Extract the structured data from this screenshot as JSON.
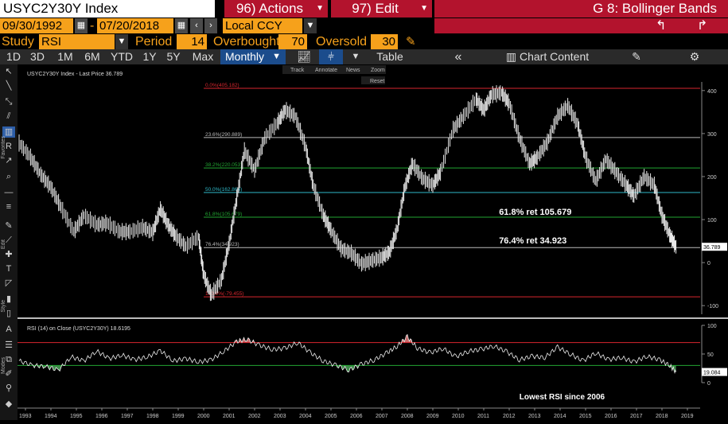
{
  "header": {
    "ticker": "USYC2Y30Y Index",
    "actions_label": "96) Actions",
    "edit_label": "97) Edit",
    "function_title": "G 8: Bollinger Bands"
  },
  "range": {
    "start_date": "09/30/1992",
    "end_date": "07/20/2018",
    "dash": "-",
    "currency": "Local CCY"
  },
  "study": {
    "study_label": "Study",
    "study_value": "RSI",
    "period_label": "Period",
    "period_value": "14",
    "overbought_label": "Overbought",
    "overbought_value": "70",
    "oversold_label": "Oversold",
    "oversold_value": "30"
  },
  "toolbar": {
    "periods": [
      "1D",
      "3D",
      "1M",
      "6M",
      "YTD",
      "1Y",
      "5Y",
      "Max"
    ],
    "frequency": "Monthly",
    "table_label": "Table",
    "chart_content_label": "Chart Content",
    "collapse_label": "«"
  },
  "chart_tools": {
    "track": "Track",
    "annotate": "Annotate",
    "news": "News",
    "zoom": "Zoom",
    "reset": "Reset"
  },
  "side_labels": {
    "favorites": "Favorites",
    "edit": "Edit",
    "style": "Style",
    "modes": "Modes"
  },
  "price_panel": {
    "legend": "USYC2Y30Y Index - Last Price 36.789",
    "last_price_tag": "36.789"
  },
  "rsi_panel": {
    "legend": "RSI (14) on Close (USYC2Y30Y) 18.6195",
    "last_tag": "19.084"
  },
  "chart_data": [
    {
      "type": "line",
      "title": "USYC2Y30Y Index - Last Price 36.789",
      "x_range": [
        1992.75,
        2019.5
      ],
      "ylim": [
        -120,
        420
      ],
      "y_ticks": [
        400,
        300,
        200,
        100,
        0,
        -100
      ],
      "x_ticks": [
        "1993",
        "1994",
        "1995",
        "1996",
        "1997",
        "1998",
        "1999",
        "2000",
        "2001",
        "2002",
        "2003",
        "2004",
        "2005",
        "2006",
        "2007",
        "2008",
        "2009",
        "2010",
        "2011",
        "2012",
        "2013",
        "2014",
        "2015",
        "2016",
        "2017",
        "2018",
        "2019"
      ],
      "grid": false,
      "fib_levels": [
        {
          "label": "0.0%(405.182)",
          "value": 405.182,
          "color": "#d9262e"
        },
        {
          "label": "23.6%(290.889)",
          "value": 290.889,
          "color": "#bbbbbb"
        },
        {
          "label": "38.2%(220.053)",
          "value": 220.053,
          "color": "#22a532"
        },
        {
          "label": "50.0%(162.864)",
          "value": 162.864,
          "color": "#2fb9c9"
        },
        {
          "label": "61.8%(105.679)",
          "value": 105.679,
          "color": "#22a532"
        },
        {
          "label": "76.4%(34.923)",
          "value": 34.923,
          "color": "#bbbbbb"
        },
        {
          "label": "100.0%(-79.455)",
          "value": -79.455,
          "color": "#d9262e"
        }
      ],
      "annotations": [
        "61.8% ret 105.679",
        "76.4% ret 34.923"
      ],
      "series": [
        {
          "x": [
            1992.75,
            1993.2,
            1993.6,
            1994.0,
            1994.4,
            1994.9,
            1995.3,
            1995.8,
            1996.2,
            1996.7,
            1997.1,
            1997.6,
            1998.0,
            1998.3,
            1998.6,
            1998.9,
            1999.3,
            1999.8,
            2000.0,
            2000.3,
            2000.7,
            2001.0,
            2001.3,
            2001.6,
            2002.0,
            2002.4,
            2002.9,
            2003.2,
            2003.6,
            2004.0,
            2004.3,
            2004.7,
            2005.0,
            2005.4,
            2005.8,
            2006.2,
            2006.6,
            2007.0,
            2007.3,
            2007.6,
            2007.9,
            2008.2,
            2008.6,
            2009.0,
            2009.3,
            2009.8,
            2010.2,
            2010.7,
            2011.0,
            2011.3,
            2011.7,
            2012.0,
            2012.4,
            2012.8,
            2013.1,
            2013.5,
            2013.9,
            2014.3,
            2014.7,
            2015.0,
            2015.4,
            2015.8,
            2016.2,
            2016.6,
            2016.9,
            2017.3,
            2017.7,
            2018.0,
            2018.3,
            2018.55
          ],
          "values": [
            278,
            245,
            205,
            175,
            128,
            72,
            110,
            88,
            92,
            72,
            72,
            82,
            70,
            125,
            88,
            62,
            38,
            60,
            -28,
            -75,
            -40,
            45,
            150,
            260,
            215,
            290,
            325,
            355,
            340,
            270,
            180,
            110,
            75,
            32,
            22,
            -3,
            5,
            12,
            25,
            78,
            175,
            230,
            195,
            180,
            210,
            310,
            340,
            380,
            355,
            390,
            395,
            370,
            290,
            230,
            245,
            280,
            340,
            365,
            320,
            245,
            190,
            240,
            210,
            180,
            155,
            200,
            180,
            110,
            65,
            36.789
          ]
        }
      ]
    },
    {
      "type": "line",
      "title": "RSI (14) on Close (USYC2Y30Y) 18.6195",
      "ylim": [
        0,
        100
      ],
      "y_ticks": [
        100,
        50,
        0
      ],
      "overbought": 70,
      "oversold": 30,
      "annotations": [
        "Lowest RSI since 2006"
      ],
      "series": [
        {
          "x": [
            1992.75,
            1993.3,
            1993.8,
            1994.3,
            1994.8,
            1995.3,
            1995.8,
            1996.3,
            1996.8,
            1997.3,
            1997.8,
            1998.3,
            1998.8,
            1999.3,
            1999.8,
            2000.3,
            2000.8,
            2001.3,
            2001.7,
            2002.2,
            2002.7,
            2003.2,
            2003.7,
            2004.2,
            2004.7,
            2005.2,
            2005.7,
            2006.2,
            2006.7,
            2007.2,
            2007.6,
            2008.0,
            2008.4,
            2008.9,
            2009.4,
            2009.9,
            2010.4,
            2010.9,
            2011.4,
            2011.9,
            2012.4,
            2012.9,
            2013.4,
            2013.9,
            2014.4,
            2014.9,
            2015.4,
            2015.9,
            2016.4,
            2016.9,
            2017.4,
            2017.9,
            2018.3,
            2018.55
          ],
          "values": [
            38,
            30,
            28,
            22,
            45,
            38,
            55,
            42,
            48,
            40,
            45,
            56,
            38,
            42,
            36,
            40,
            55,
            72,
            76,
            65,
            58,
            60,
            70,
            52,
            38,
            30,
            22,
            32,
            40,
            52,
            64,
            80,
            60,
            52,
            60,
            45,
            55,
            58,
            64,
            54,
            40,
            46,
            44,
            62,
            50,
            38,
            52,
            40,
            44,
            36,
            46,
            40,
            30,
            18.6195
          ]
        }
      ]
    }
  ]
}
